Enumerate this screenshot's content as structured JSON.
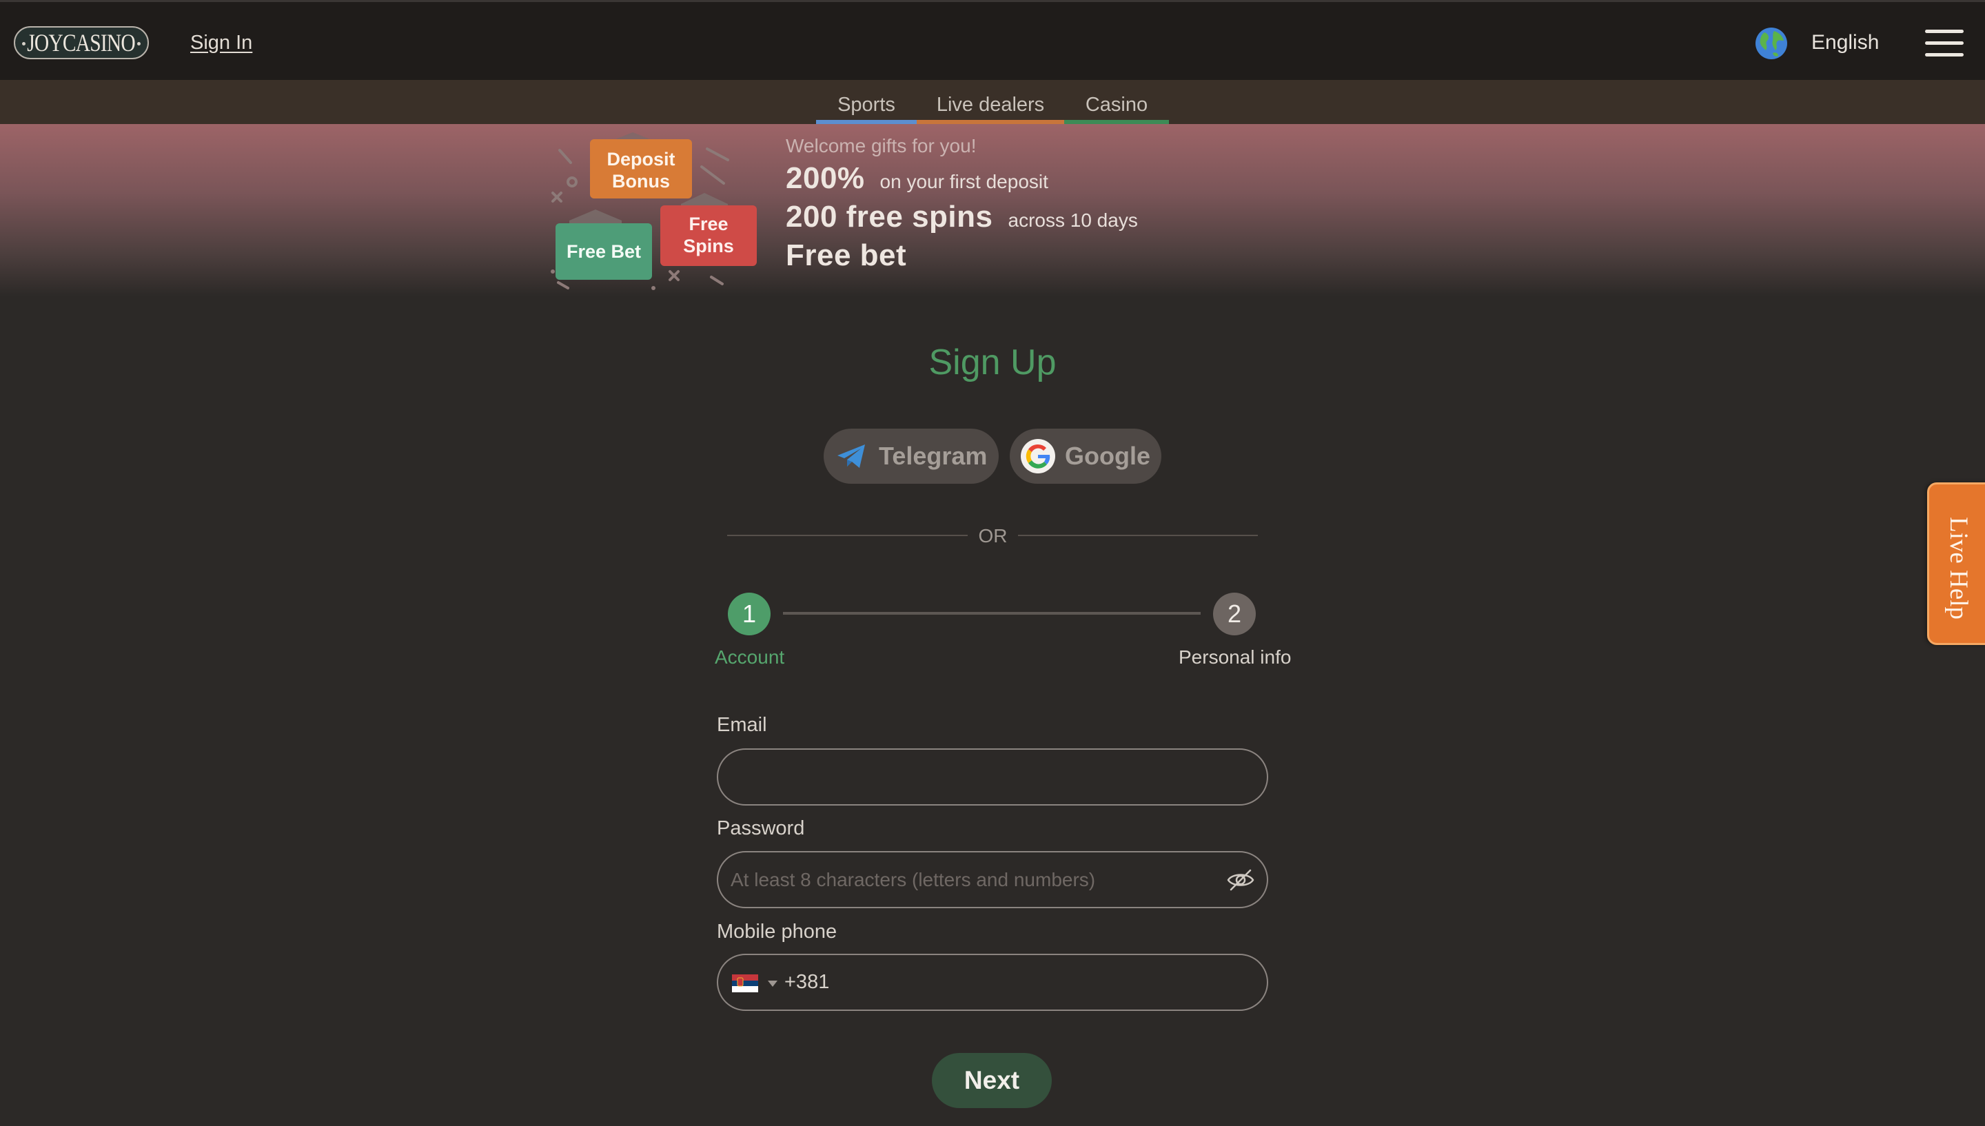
{
  "header": {
    "logo_text": "JOYCASINO",
    "signin_label": "Sign In",
    "language_label": "English"
  },
  "nav": {
    "tabs": [
      {
        "label": "Sports",
        "color": "#5c8fd0"
      },
      {
        "label": "Live dealers",
        "color": "#c8753b"
      },
      {
        "label": "Casino",
        "color": "#3d8b56"
      }
    ]
  },
  "promo": {
    "art": {
      "deposit_bonus_line1": "Deposit",
      "deposit_bonus_line2": "Bonus",
      "free_spins_line1": "Free",
      "free_spins_line2": "Spins",
      "free_bet": "Free Bet"
    },
    "welcome": "Welcome gifts for you!",
    "line1_big": "200%",
    "line1_small": "on your first deposit",
    "line2_big": "200 free spins",
    "line2_small": "across 10 days",
    "line3_big": "Free bet"
  },
  "signup": {
    "title": "Sign Up",
    "social": [
      {
        "label": "Telegram",
        "icon": "telegram-icon"
      },
      {
        "label": "Google",
        "icon": "google-icon"
      }
    ],
    "or_label": "OR",
    "steps": [
      {
        "number": "1",
        "label": "Account",
        "active": true
      },
      {
        "number": "2",
        "label": "Personal info",
        "active": false
      }
    ],
    "fields": {
      "email_label": "Email",
      "email_value": "",
      "password_label": "Password",
      "password_placeholder": "At least 8 characters (letters and numbers)",
      "phone_label": "Mobile phone",
      "phone_code": "+381",
      "phone_flag": "serbia-flag-icon"
    },
    "next_label": "Next"
  },
  "live_help_label": "Live Help",
  "colors": {
    "accent_green": "#4e9d69",
    "background": "#2c2927",
    "live_help": "#e5762c"
  }
}
